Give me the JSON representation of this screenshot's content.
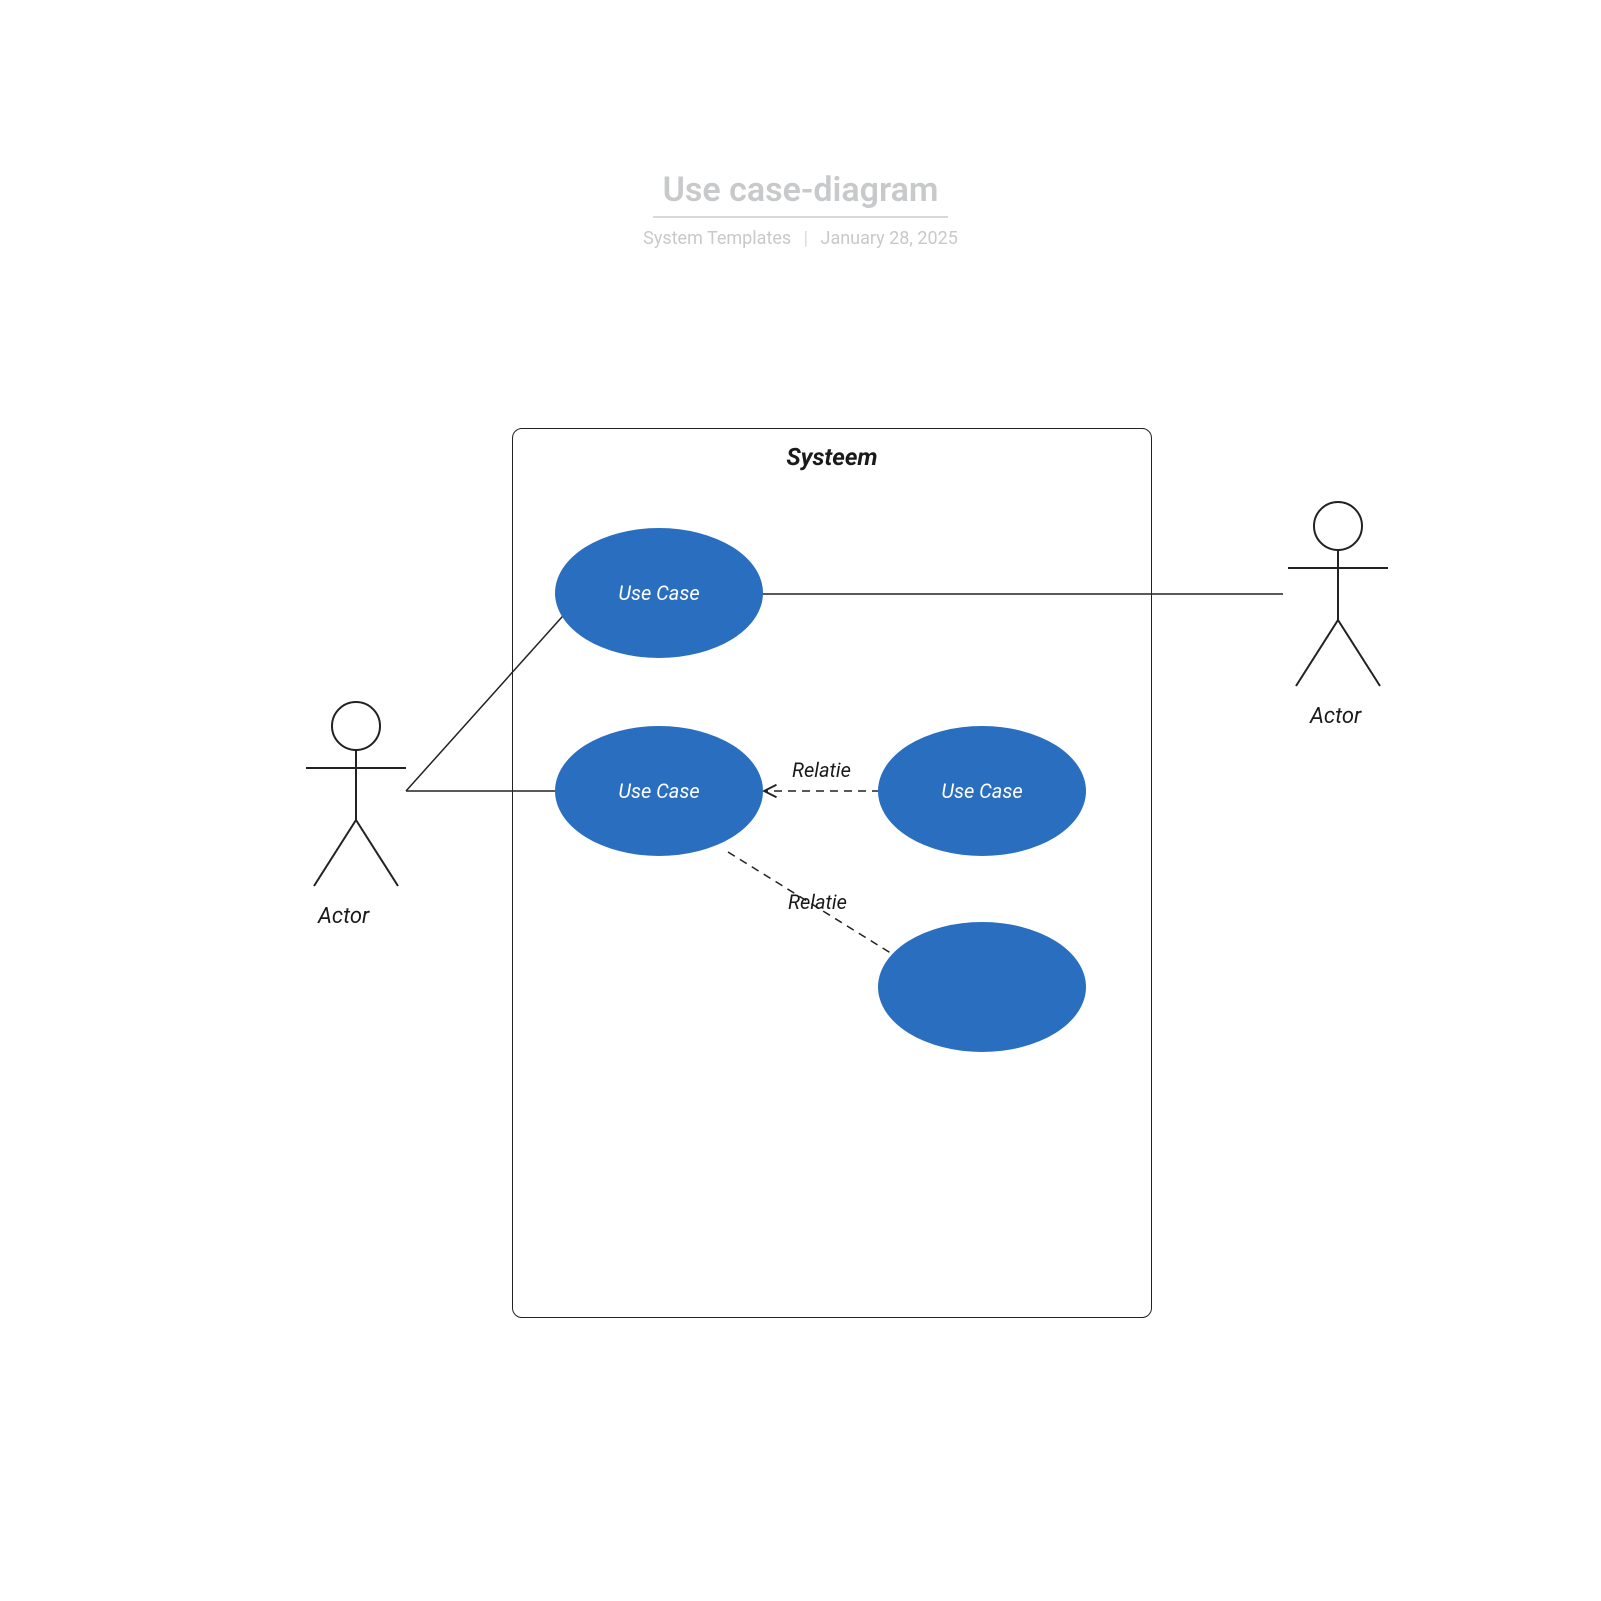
{
  "header": {
    "title": "Use case-diagram",
    "subtitle_left": "System Templates",
    "subtitle_right": "January 28, 2025"
  },
  "system": {
    "title": "Systeem"
  },
  "usecases": {
    "uc1": "Use Case",
    "uc2": "Use Case",
    "uc3": "Use Case",
    "uc4": ""
  },
  "actors": {
    "left": "Actor",
    "right": "Actor"
  },
  "relations": {
    "r1": "Relatie",
    "r2": "Relatie"
  },
  "colors": {
    "usecase_fill": "#2a6fbf",
    "stroke": "#222222"
  }
}
